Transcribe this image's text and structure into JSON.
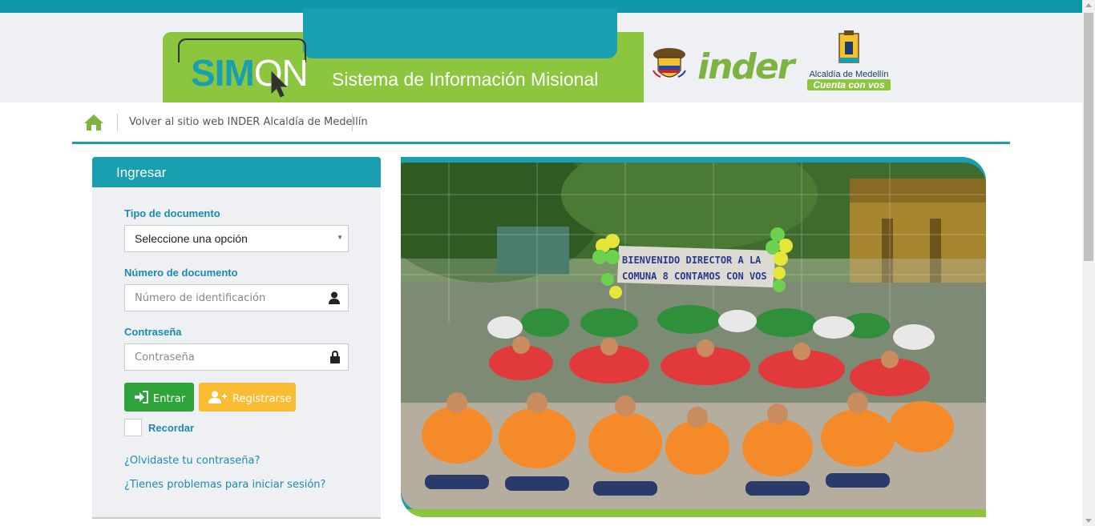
{
  "header": {
    "logo_sim": "SIM",
    "logo_on": "ON",
    "tagline": "Sistema de Información Misional",
    "partner_inder": "inder",
    "alcaldia_name": "Alcaldía de Medellín",
    "alcaldia_slogan": "Cuenta con vos"
  },
  "nav": {
    "back_link": "Volver al sitio web INDER Alcaldía de Medellín"
  },
  "login": {
    "title": "Ingresar",
    "doc_type_label": "Tipo de documento",
    "doc_type_value": "Seleccione una opción",
    "doc_number_label": "Número de documento",
    "doc_number_placeholder": "Número de identificación",
    "password_label": "Contraseña",
    "password_placeholder": "Contraseña",
    "submit_label": "Entrar",
    "register_label": "Registrarse",
    "remember_label": "Recordar",
    "forgot_link": "¿Olvidaste tu contraseña?",
    "help_link": "¿Tienes problemas para iniciar sesión?"
  },
  "photo": {
    "banner_line1": "BIENVENIDO DIRECTOR A LA",
    "banner_line2": "COMUNA 8 CONTAMOS CON VOS"
  },
  "colors": {
    "teal": "#1a9fb0",
    "green": "#8cc63f",
    "enter_green": "#2ea33a",
    "register_yellow": "#f8bd32"
  }
}
